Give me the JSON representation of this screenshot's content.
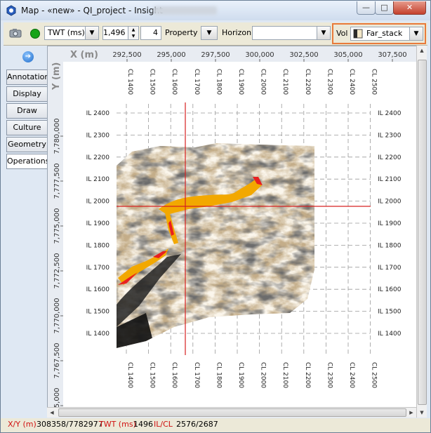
{
  "window": {
    "title": "Map - «new» - QI_project - Insight",
    "controls": {
      "minimize": "—",
      "maximize": "□",
      "close": "✕"
    }
  },
  "toolbar": {
    "time_domain": "TWT (ms)",
    "inline_value": "1,496",
    "step_value": "4",
    "property_label": "Property",
    "horizon_label": "Horizon",
    "horizon_value": "",
    "vol_label": "Vol",
    "vol_value": "Far_stack"
  },
  "side_tabs": [
    {
      "label": "Annotation"
    },
    {
      "label": "Display"
    },
    {
      "label": "Draw"
    },
    {
      "label": "Culture"
    },
    {
      "label": "Geometry"
    },
    {
      "label": "Operations"
    }
  ],
  "map": {
    "x_axis_title": "X (m)",
    "y_axis_title": "Y (m)",
    "x_ticks": [
      "292,500",
      "295,000",
      "297,500",
      "300,000",
      "302,500",
      "305,000",
      "307,500"
    ],
    "y_ticks": [
      "7,780,000",
      "7,777,500",
      "7,775,000",
      "7,772,500",
      "7,770,000",
      "7,767,500",
      "7,765,000"
    ],
    "crosslines": [
      "CL 1400",
      "CL 1500",
      "CL 1600",
      "CL 1700",
      "CL 1800",
      "CL 1900",
      "CL 2000",
      "CL 2100",
      "CL 2200",
      "CL 2300",
      "CL 2400",
      "CL 2500"
    ],
    "inlines": [
      "IL 2400",
      "IL 2300",
      "IL 2200",
      "IL 2100",
      "IL 2000",
      "IL 1900",
      "IL 1800",
      "IL 1700",
      "IL 1600",
      "IL 1500",
      "IL 1400"
    ],
    "crosshair_color": "#d62020"
  },
  "status": {
    "xy_label": "X/Y (m)",
    "xy_value": "308358/7782977",
    "twt_label": "TWT (ms)",
    "twt_value": "1496",
    "ilcl_label": "IL/CL",
    "ilcl_value": "2576/2687"
  }
}
